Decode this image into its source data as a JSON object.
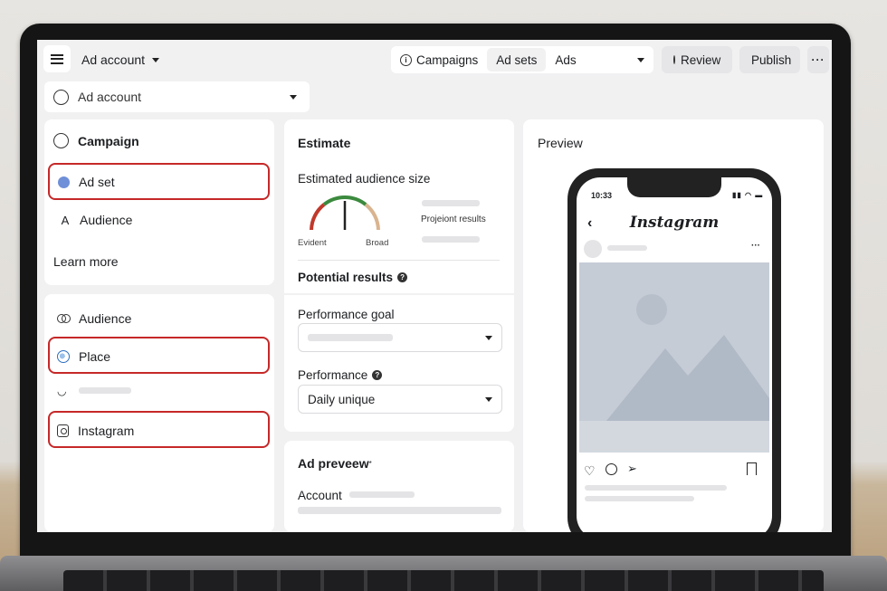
{
  "topbar": {
    "account_label": "Ad account",
    "tabs": [
      {
        "label": "Campaigns",
        "icon": "info-icon"
      },
      {
        "label": "Ad sets",
        "active": true
      },
      {
        "label": "Ads"
      }
    ],
    "review_label": "Review",
    "publish_label": "Publish",
    "more_label": "···"
  },
  "account_dropdown": {
    "value": "Ad account"
  },
  "left_panel": {
    "campaign_label": "Campaign",
    "adset_label": "Ad set",
    "audience_label": "Audience",
    "learn_more": "Learn more"
  },
  "placements_panel": {
    "audience_label": "Audience",
    "place_label": "Place",
    "instagram_label": "Instagram"
  },
  "estimate": {
    "title": "Estimate",
    "audience_size_label": "Estimated audience size",
    "gauge_left": "Evident",
    "gauge_right": "Broad",
    "projected_results": "Projeiont results",
    "potential_results": "Potential results",
    "performance_goal_label": "Performance goal",
    "performance_label": "Performance",
    "performance_value": "Daily unique"
  },
  "ad_preview": {
    "title": "Ad preveew",
    "title_mark": "*",
    "account_label": "Account"
  },
  "preview": {
    "title": "Preview",
    "time": "10:33",
    "app_name": "Instagram"
  },
  "colors": {
    "highlight": "#c62828",
    "selected_dot": "#6f8fd8",
    "gauge_green": "#3b8a3e",
    "gauge_red": "#c0392b"
  }
}
